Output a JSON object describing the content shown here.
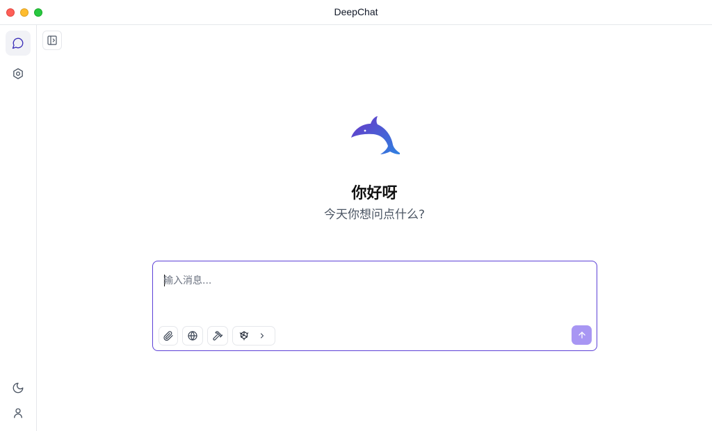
{
  "window": {
    "title": "DeepChat"
  },
  "sidebar": {
    "top_items": [
      {
        "name": "chat",
        "icon": "chat-bubble-icon",
        "active": true
      },
      {
        "name": "settings",
        "icon": "settings-icon",
        "active": false
      }
    ],
    "bottom_items": [
      {
        "name": "theme",
        "icon": "moon-icon"
      },
      {
        "name": "profile",
        "icon": "user-icon"
      }
    ]
  },
  "header": {
    "toggle_icon": "sidebar-toggle-icon"
  },
  "hero": {
    "logo_icon": "dolphin-logo-icon",
    "greeting": "你好呀",
    "subtitle": "今天你想问点什么?"
  },
  "composer": {
    "placeholder": "输入消息...",
    "value": "",
    "tools": [
      {
        "name": "attach",
        "icon": "paperclip-icon"
      },
      {
        "name": "web-search",
        "icon": "globe-icon"
      },
      {
        "name": "tools",
        "icon": "hammer-icon"
      }
    ],
    "model": {
      "icon": "openai-icon",
      "expand_icon": "chevron-right-icon"
    },
    "send_icon": "arrow-up-icon"
  },
  "colors": {
    "accent": "#5b3fd6",
    "send_button": "#a896f3",
    "logo_gradient_start": "#6a36c7",
    "logo_gradient_end": "#2f80e0",
    "border": "#e5e7eb"
  }
}
